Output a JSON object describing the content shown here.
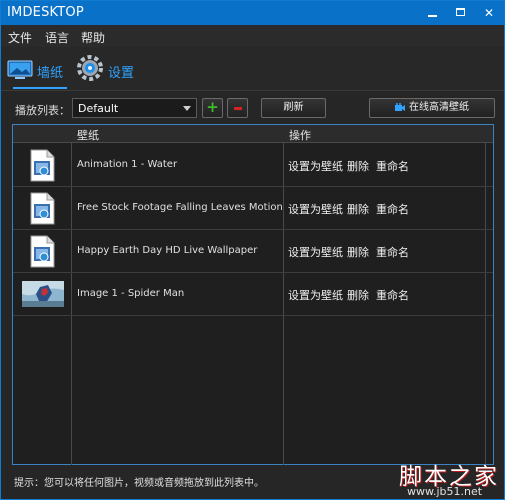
{
  "window": {
    "title": "IMDESKTOP",
    "minimize_icon": "minimize-icon",
    "maximize_icon": "maximize-icon",
    "close_glyph": "✕"
  },
  "menu": [
    "文件",
    "语言",
    "帮助"
  ],
  "tabs": [
    {
      "label": "墙纸",
      "icon": "wallpaper-icon",
      "selected": true
    },
    {
      "label": "设置",
      "icon": "gear-icon",
      "selected": false
    }
  ],
  "toolbar": {
    "playlist_label": "播放列表：",
    "playlist_value": "Default",
    "add_glyph": "+",
    "refresh_label": "刷新",
    "online_label": "在线高清壁纸",
    "online_icon": "camera-icon"
  },
  "table": {
    "headers": [
      "",
      "壁纸",
      "操作"
    ],
    "rows": [
      {
        "thumb": "audio-file-icon",
        "name": "Animation 1 - Water"
      },
      {
        "thumb": "audio-file-icon",
        "name": "Free Stock Footage Falling Leaves Motion Background"
      },
      {
        "thumb": "audio-file-icon",
        "name": "Happy Earth Day HD Live Wallpaper"
      },
      {
        "thumb": "image-thumbnail",
        "name": "Image 1 - Spider Man"
      }
    ],
    "actions": {
      "set": "设置为壁纸",
      "delete": "删除",
      "rename": "重命名"
    }
  },
  "hint": "提示：您可以将任何图片，视频或音频拖放到此列表中。",
  "watermark": {
    "big": "脚本之家",
    "small": "www.jb51.net"
  },
  "colors": {
    "accent": "#0a71c9",
    "tab_text": "#2fa3ff",
    "add_green": "#3dbb2b",
    "remove_red": "#d42323"
  }
}
